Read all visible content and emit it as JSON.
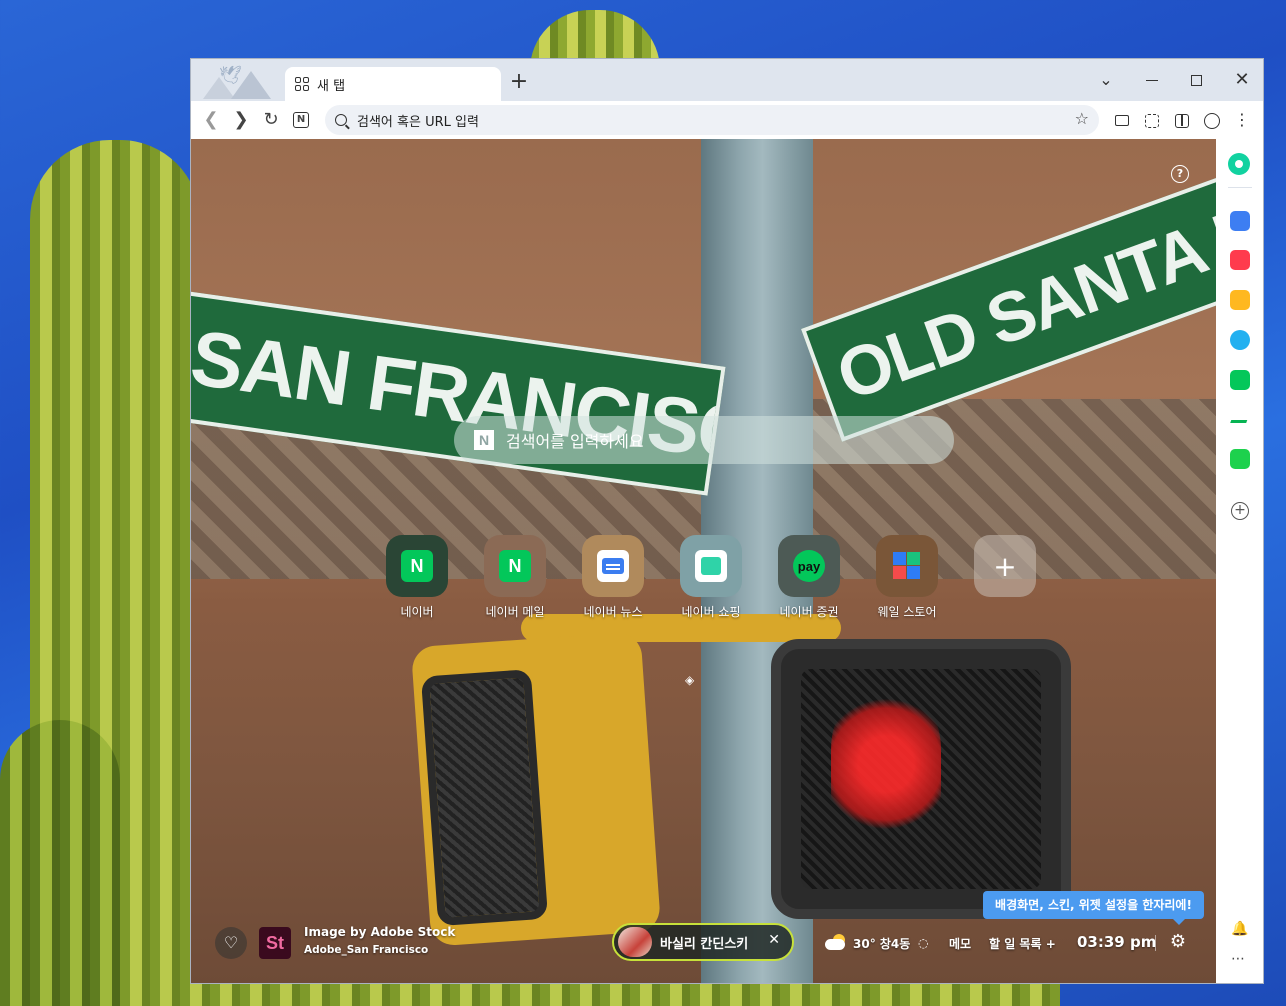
{
  "tab": {
    "title": "새 탭"
  },
  "address_bar": {
    "placeholder": "검색어 혹은 URL 입력"
  },
  "sign_text": {
    "left": "SAN FRANCISCO ST",
    "right": "OLD SANTA FE TRAIL"
  },
  "search": {
    "placeholder": "검색어를 입력하세요",
    "logo": "N"
  },
  "shortcuts": [
    {
      "label": "네이버",
      "glyph": "N"
    },
    {
      "label": "네이버 메일",
      "glyph": "N"
    },
    {
      "label": "네이버 뉴스"
    },
    {
      "label": "네이버 쇼핑"
    },
    {
      "label": "네이버 증권",
      "glyph": "pay"
    },
    {
      "label": "웨일 스토어"
    },
    {
      "label": "+"
    }
  ],
  "background_credit": {
    "logo": "St",
    "line1": "Image by Adobe Stock",
    "line2": "Adobe_San Francisco"
  },
  "promo_pill": {
    "text": "바실리 칸딘스키",
    "close": "✕"
  },
  "weather": {
    "text": "30° 창4동"
  },
  "widgets": {
    "memo": "메모",
    "todo": "할 일 목록 +",
    "clock": "03:39 pm"
  },
  "tooltip": {
    "text": "배경화면, 스킨, 위젯 설정을 한자리에!"
  },
  "colors": {
    "naver_green": "#03c75a",
    "tooltip_blue": "#4c9bf0",
    "pill_border": "#c7e13a"
  }
}
